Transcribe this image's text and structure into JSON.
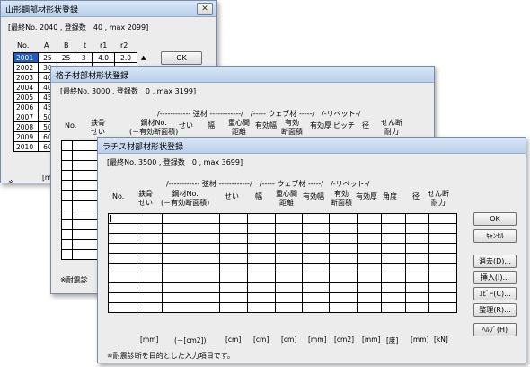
{
  "win1": {
    "title": "山形鋼部材形状登録",
    "info": "[最終No. 2040 , 登録数　40 , max 2099]",
    "headers": [
      "No.",
      "A",
      "B",
      "t",
      "r1",
      "r2"
    ],
    "first_row": [
      "2001",
      "25",
      "25",
      "3",
      "4.0",
      "2.0"
    ],
    "row_numbers": [
      "2002",
      "2003",
      "2004",
      "2005",
      "2006",
      "2007",
      "2008",
      "2009",
      "2010"
    ],
    "row_partials": [
      "30",
      "40",
      "40",
      "45",
      "45",
      "50",
      "50",
      "60",
      "60"
    ],
    "ok_label": "OK",
    "unit_stub": "[mm",
    "footnote_stub": "※"
  },
  "win2": {
    "title": "格子材部材形状登録",
    "info": "[最終No. 3000 , 登録数　0 , max 3199]",
    "group_header": "/------------ 弦材 ------------/　/----- ウェブ材 -----/　/-リベット-/",
    "headers": [
      "No.",
      "鉄骨\nせい",
      "鋼材No.\n(－有効断面積)",
      "せい",
      "幅",
      "重心間\n距離",
      "有効幅",
      "有効\n断面積",
      "有効厚",
      "ピッチ",
      "径",
      "せん断\n耐力"
    ],
    "footnote_stub": "※耐震診"
  },
  "win3": {
    "title": "ラチス材部材形状登録",
    "info": "[最終No. 3500 , 登録数　0 , max 3699]",
    "group_header": "/------------ 弦材 ------------/　/----- ウェブ材 -----/　/-リベット-/",
    "headers": [
      "No.",
      "鉄骨\nせい",
      "鋼材No.\n(－有効断面積)",
      "せい",
      "幅",
      "重心間\n距離",
      "有効幅",
      "有効\n断面積",
      "有効厚",
      "角度",
      "径",
      "せん断\n耐力"
    ],
    "units": [
      "[mm]",
      "(－[cm2])",
      "[cm]",
      "[cm]",
      "[cm]",
      "[mm]",
      "[cm2]",
      "[mm]",
      "[度]",
      "[mm]",
      "[kN]"
    ],
    "footnote": "※耐震診断を目的とした入力項目です。",
    "buttons": {
      "ok": "OK",
      "cancel": "ｷｬﾝｾﾙ",
      "delete": "消去(D)...",
      "insert": "挿入(I)...",
      "copy": "ｺﾋﾟｰ(C)...",
      "organize": "整理(R)...",
      "help": "ﾍﾙﾌﾟ(H)"
    }
  }
}
